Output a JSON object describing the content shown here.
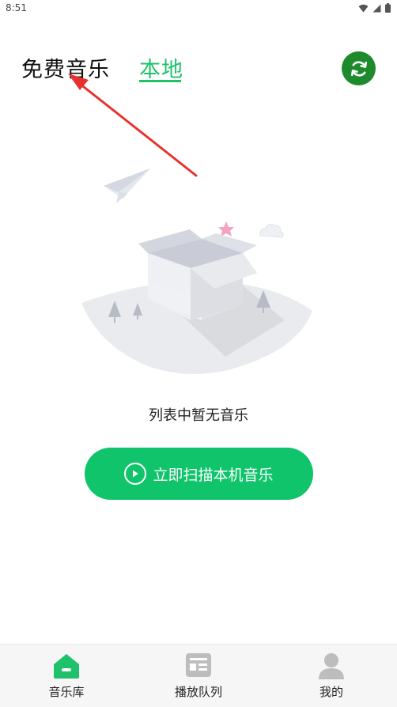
{
  "status_bar": {
    "time": "8:51"
  },
  "header": {
    "tab_free": "免费音乐",
    "tab_local": "本地"
  },
  "empty_state": {
    "message": "列表中暂无音乐",
    "scan_button_label": "立即扫描本机音乐"
  },
  "bottom_nav": {
    "items": [
      {
        "label": "音乐库",
        "icon": "home-icon"
      },
      {
        "label": "播放队列",
        "icon": "queue-icon"
      },
      {
        "label": "我的",
        "icon": "profile-icon"
      }
    ]
  },
  "colors": {
    "accent": "#1fc16a",
    "refresh_bg": "#1d8b2c",
    "annotation": "#e8312f"
  }
}
